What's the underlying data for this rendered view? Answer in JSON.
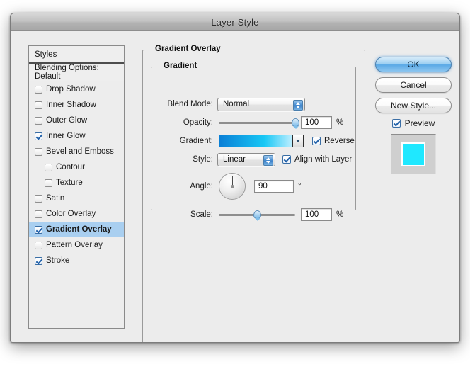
{
  "window": {
    "title": "Layer Style"
  },
  "sidebar": {
    "header": "Styles",
    "blending_options": "Blending Options: Default",
    "items": [
      {
        "label": "Drop Shadow",
        "checked": false,
        "indent": false,
        "selected": false
      },
      {
        "label": "Inner Shadow",
        "checked": false,
        "indent": false,
        "selected": false
      },
      {
        "label": "Outer Glow",
        "checked": false,
        "indent": false,
        "selected": false
      },
      {
        "label": "Inner Glow",
        "checked": true,
        "indent": false,
        "selected": false
      },
      {
        "label": "Bevel and Emboss",
        "checked": false,
        "indent": false,
        "selected": false
      },
      {
        "label": "Contour",
        "checked": false,
        "indent": true,
        "selected": false
      },
      {
        "label": "Texture",
        "checked": false,
        "indent": true,
        "selected": false
      },
      {
        "label": "Satin",
        "checked": false,
        "indent": false,
        "selected": false
      },
      {
        "label": "Color Overlay",
        "checked": false,
        "indent": false,
        "selected": false
      },
      {
        "label": "Gradient Overlay",
        "checked": true,
        "indent": false,
        "selected": true
      },
      {
        "label": "Pattern Overlay",
        "checked": false,
        "indent": false,
        "selected": false
      },
      {
        "label": "Stroke",
        "checked": true,
        "indent": false,
        "selected": false
      }
    ]
  },
  "panel": {
    "outer_title": "Gradient Overlay",
    "inner_title": "Gradient",
    "blend_mode": {
      "label": "Blend Mode:",
      "value": "Normal"
    },
    "opacity": {
      "label": "Opacity:",
      "value": "100",
      "unit": "%",
      "percent": 100
    },
    "gradient": {
      "label": "Gradient:",
      "start_color": "#0a7fd6",
      "mid_color": "#18c8f5",
      "end_color": "#bfeeff",
      "reverse_label": "Reverse",
      "reverse_checked": true
    },
    "style": {
      "label": "Style:",
      "value": "Linear",
      "align_label": "Align with Layer",
      "align_checked": true
    },
    "angle": {
      "label": "Angle:",
      "value": "90",
      "unit": "°",
      "degrees": 90
    },
    "scale": {
      "label": "Scale:",
      "value": "100",
      "unit": "%",
      "percent": 50
    }
  },
  "actions": {
    "ok": "OK",
    "cancel": "Cancel",
    "new_style": "New Style...",
    "preview_label": "Preview",
    "preview_checked": true,
    "preview_swatch_color": "#1fe8ff",
    "preview_stroke_color": "#ffffff",
    "preview_bg_color": "#cfcfcf"
  }
}
